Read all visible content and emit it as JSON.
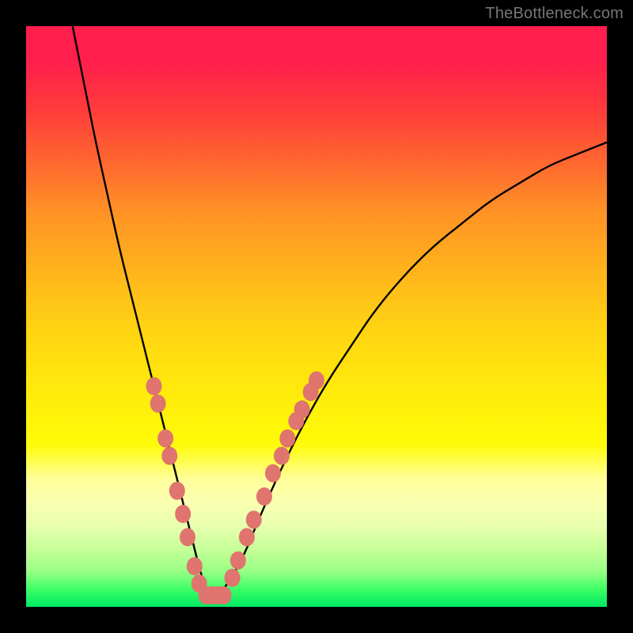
{
  "watermark": {
    "text": "TheBottleneck.com"
  },
  "colors": {
    "frame": "#000000",
    "curve_stroke": "#000000",
    "marker_fill": "#e0746e",
    "marker_stroke": "#c85c56",
    "watermark": "#777777",
    "gradient_stops": [
      "#ff1e4c",
      "#ff3a3c",
      "#ff6a2f",
      "#ff9225",
      "#ffb31c",
      "#ffd313",
      "#ffe90c",
      "#fffb07",
      "#ffff9a",
      "#faffb0",
      "#e8ffae",
      "#c7ff98",
      "#97ff84",
      "#3bff65",
      "#00e863"
    ]
  },
  "chart_data": {
    "type": "line",
    "title": "",
    "xlabel": "",
    "ylabel": "",
    "xlim": [
      0,
      100
    ],
    "ylim": [
      0,
      100
    ],
    "grid": false,
    "series": [
      {
        "name": "curve",
        "x": [
          8,
          10,
          12,
          14,
          16,
          18,
          20,
          22,
          24,
          26,
          27,
          28,
          29,
          30,
          31,
          32,
          33,
          34,
          36,
          38,
          40,
          44,
          48,
          52,
          56,
          60,
          65,
          70,
          75,
          80,
          85,
          90,
          95,
          100
        ],
        "y": [
          100,
          90,
          80,
          71,
          62,
          54,
          46,
          38,
          30,
          22,
          18,
          14,
          10,
          6,
          3,
          2,
          2,
          3,
          6,
          10,
          15,
          24,
          32,
          39,
          45,
          51,
          57,
          62,
          66,
          70,
          73,
          76,
          78,
          80
        ]
      }
    ],
    "markers": {
      "left_branch": [
        {
          "x": 22.0,
          "y": 38
        },
        {
          "x": 22.7,
          "y": 35
        },
        {
          "x": 24.0,
          "y": 29
        },
        {
          "x": 24.7,
          "y": 26
        },
        {
          "x": 26.0,
          "y": 20
        },
        {
          "x": 27.0,
          "y": 16
        },
        {
          "x": 27.8,
          "y": 12
        },
        {
          "x": 29.0,
          "y": 7
        },
        {
          "x": 29.8,
          "y": 4
        }
      ],
      "bottom": [
        {
          "x": 31.0,
          "y": 2
        },
        {
          "x": 32.0,
          "y": 2
        },
        {
          "x": 33.0,
          "y": 2
        },
        {
          "x": 34.0,
          "y": 2
        }
      ],
      "right_branch": [
        {
          "x": 35.5,
          "y": 5
        },
        {
          "x": 36.5,
          "y": 8
        },
        {
          "x": 38.0,
          "y": 12
        },
        {
          "x": 39.2,
          "y": 15
        },
        {
          "x": 41.0,
          "y": 19
        },
        {
          "x": 42.5,
          "y": 23
        },
        {
          "x": 44.0,
          "y": 26
        },
        {
          "x": 45.0,
          "y": 29
        },
        {
          "x": 46.5,
          "y": 32
        },
        {
          "x": 47.5,
          "y": 34
        },
        {
          "x": 49.0,
          "y": 37
        },
        {
          "x": 50.0,
          "y": 39
        }
      ]
    }
  }
}
